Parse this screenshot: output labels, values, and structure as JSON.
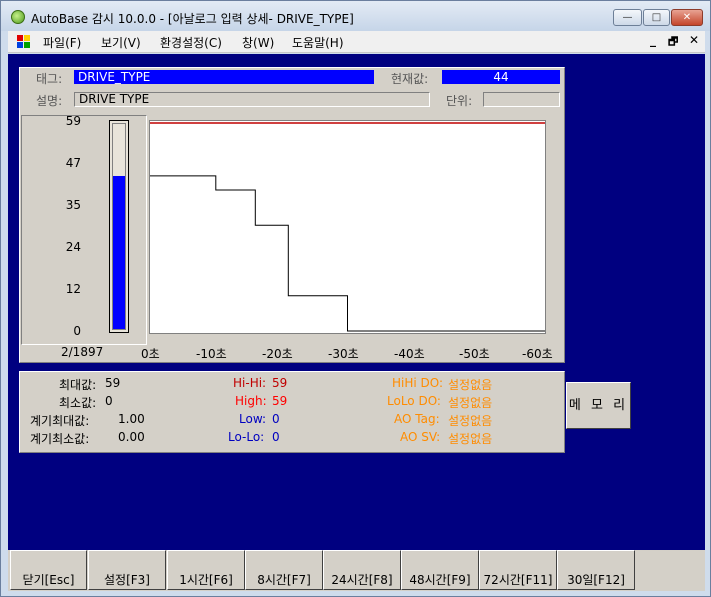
{
  "window": {
    "title": "AutoBase 감시 10.0.0 - [아날로그 입력 상세- DRIVE_TYPE]",
    "min_glyph": "—",
    "max_glyph": "□",
    "close_glyph": "✕"
  },
  "menu": {
    "items": [
      "파일(F)",
      "보기(V)",
      "환경설정(C)",
      "창(W)",
      "도움말(H)"
    ],
    "mdi_min": "_",
    "mdi_restore": "🗗",
    "mdi_close": "✕"
  },
  "detail": {
    "tag_label": "태그:",
    "tag_value": "DRIVE_TYPE",
    "current_label": "현재값:",
    "current_value": "44",
    "desc_label": "설명:",
    "desc_value": "DRIVE TYPE",
    "unit_label": "단위:",
    "unit_value": ""
  },
  "gauge": {
    "ticks": [
      "59",
      "47",
      "35",
      "24",
      "12",
      "0"
    ],
    "fill_fraction": 0.746,
    "counter": "2/1897"
  },
  "chart_data": {
    "type": "line",
    "x_ticks": [
      "0초",
      "-10초",
      "-20초",
      "-30초",
      "-40초",
      "-50초",
      "-60초"
    ],
    "xlim": [
      0,
      -60
    ],
    "ylim": [
      0,
      59
    ],
    "high_limit_line": 59,
    "series": [
      {
        "x": [
          0,
          -10,
          -10,
          -16,
          -16,
          -21,
          -21,
          -30,
          -30,
          -60
        ],
        "y": [
          44,
          44,
          40,
          40,
          30,
          30,
          10,
          10,
          0,
          0
        ]
      }
    ],
    "colors": {
      "line": "#000000",
      "limit": "#c00000"
    }
  },
  "stats": {
    "max_label": "최대값:",
    "max_value": "59",
    "min_label": "최소값:",
    "min_value": "0",
    "meter_max_label": "계기최대값:",
    "meter_max_value": "1.00",
    "meter_min_label": "계기최소값:",
    "meter_min_value": "0.00",
    "hihi_label": "Hi-Hi:",
    "hihi_value": "59",
    "high_label": "High:",
    "high_value": "59",
    "low_label": "Low:",
    "low_value": "0",
    "lolo_label": "Lo-Lo:",
    "lolo_value": "0",
    "hihi_do_label": "HiHi DO:",
    "hihi_do_value": "설정없음",
    "lolo_do_label": "LoLo DO:",
    "lolo_do_value": "설정없음",
    "ao_tag_label": "AO Tag:",
    "ao_tag_value": "설정없음",
    "ao_sv_label": "AO SV:",
    "ao_sv_value": "설정없음"
  },
  "memory_button": "메 모 리",
  "buttons": [
    "닫기[Esc]",
    "설정[F3]",
    "1시간[F6]",
    "8시간[F7]",
    "24시간[F8]",
    "48시간[F9]",
    "72시간[F11]",
    "30일[F12]"
  ]
}
